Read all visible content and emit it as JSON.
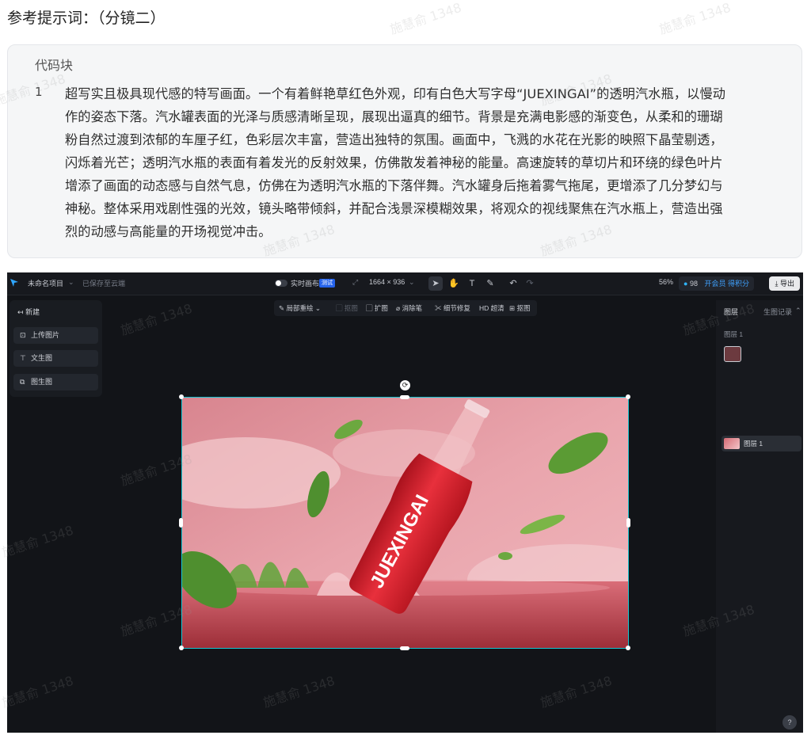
{
  "heading": "参考提示词：（分镜二）",
  "code_block": {
    "title": "代码块",
    "line_number": "1",
    "lines": [
      "超写实且极具现代感的特写画面。一个有着鲜艳草红色外观，印有白色大写字母“JUEXINGAI”的透明汽水瓶，以慢动",
      "作的姿态下落。汽水罐表面的光泽与质感清晰呈现，展现出逼真的细节。背景是充满电影感的渐变色，从柔和的珊瑚",
      "粉自然过渡到浓郁的车厘子红，色彩层次丰富，营造出独特的氛围。画面中，飞溅的水花在光影的映照下晶莹剔透，",
      "闪烁着光芒；透明汽水瓶的表面有着发光的反射效果，仿佛散发着神秘的能量。高速旋转的草切片和环绕的绿色叶片",
      "增添了画面的动态感与自然气息，仿佛在为透明汽水瓶的下落伴舞。汽水罐身后拖着雾气拖尾，更增添了几分梦幻与",
      "神秘。整体采用戏剧性强的光效，镜头略带倾斜，并配合浅景深模糊效果，将观众的视线聚焦在汽水瓶上，营造出强",
      "烈的动感与高能量的开场视觉冲击。"
    ]
  },
  "editor": {
    "project_name": "未命名项目",
    "save_status": "已保存至云端",
    "realtime_canvas_label": "实时画布",
    "beta_badge": "测试",
    "canvas_size": "1664 × 936",
    "zoom": "56%",
    "credits": "98",
    "vip_text": "开会员 得积分",
    "export_label": "导出",
    "left_panel": {
      "new_label": "新建",
      "buttons": [
        "上传图片",
        "文生图",
        "图生图"
      ]
    },
    "sub_toolbar": {
      "items": [
        "局部重绘",
        "抠图",
        "扩图",
        "消除笔",
        "细节修复",
        "超清",
        "抠图"
      ],
      "hd_prefix": "HD"
    },
    "right_panel": {
      "tab_layers": "图层",
      "tab_history": "生图记录",
      "layer_group_label": "图层 1",
      "layer_row_label": "图层 1"
    },
    "canvas_text": "JUEXINGAI",
    "help_label": "?"
  },
  "watermark_text": "施慧俞 1348",
  "colors": {
    "accent": "#17c5d2",
    "editor_bg": "#121418",
    "bottle_red": "#d9232f",
    "bg_pink": "#e79aa3"
  }
}
